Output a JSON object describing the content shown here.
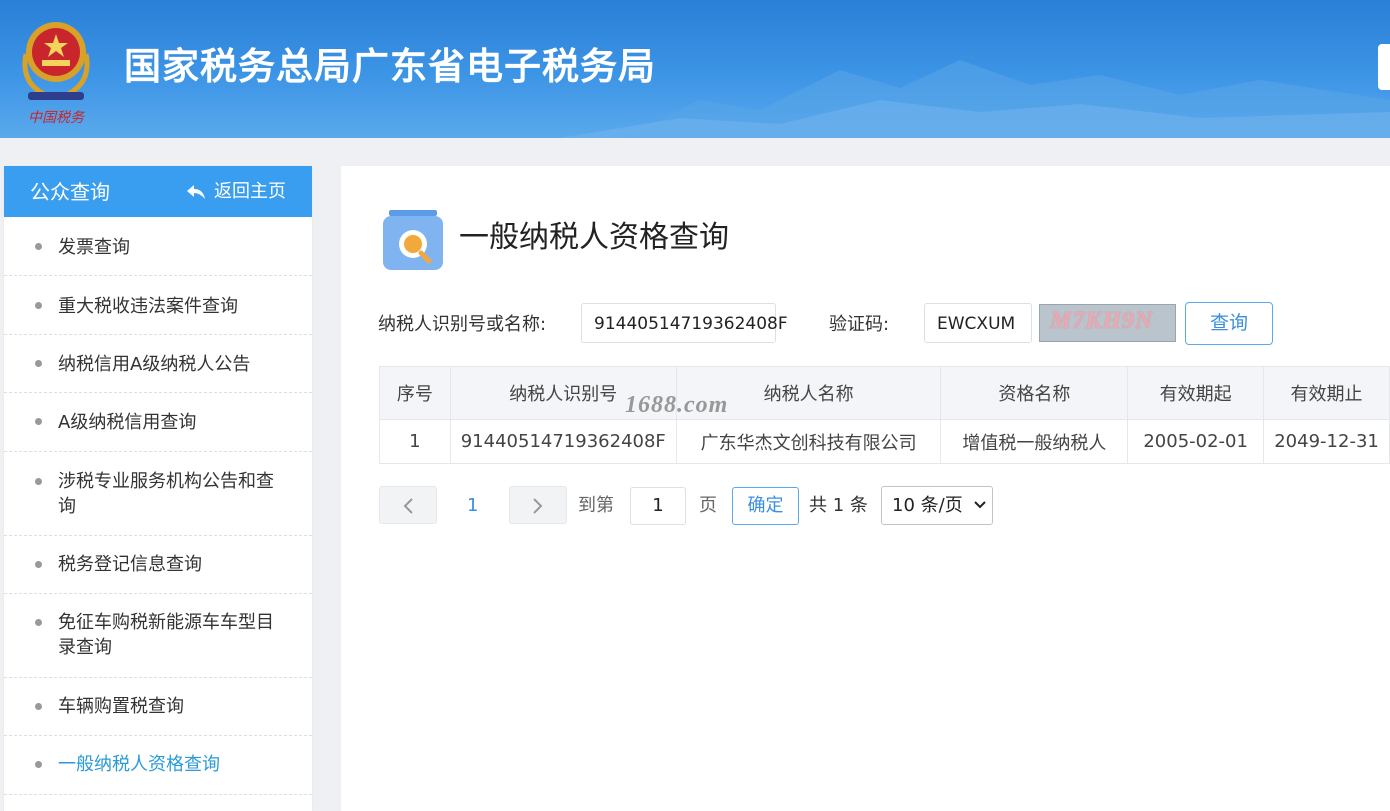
{
  "header": {
    "title": "国家税务总局广东省电子税务局",
    "emblem_caption": "中国税务"
  },
  "sidebar": {
    "title": "公众查询",
    "back_label": "返回主页",
    "items": [
      {
        "label": "发票查询"
      },
      {
        "label": "重大税收违法案件查询"
      },
      {
        "label": "纳税信用A级纳税人公告"
      },
      {
        "label": "A级纳税信用查询"
      },
      {
        "label": "涉税专业服务机构公告和查询"
      },
      {
        "label": "税务登记信息查询"
      },
      {
        "label": "免征车购税新能源车车型目录查询"
      },
      {
        "label": "车辆购置税查询"
      },
      {
        "label": "一般纳税人资格查询",
        "active": true
      }
    ]
  },
  "main": {
    "page_title": "一般纳税人资格查询",
    "form": {
      "taxpayer_label": "纳税人识别号或名称:",
      "taxpayer_value": "91440514719362408F",
      "captcha_label": "验证码:",
      "captcha_value": "EWCXUM",
      "captcha_image_text": "M7KH9N",
      "query_button": "查询"
    },
    "table": {
      "headers": [
        "序号",
        "纳税人识别号",
        "纳税人名称",
        "资格名称",
        "有效期起",
        "有效期止"
      ],
      "rows": [
        [
          "1",
          "91440514719362408F",
          "广东华杰文创科技有限公司",
          "增值税一般纳税人",
          "2005-02-01",
          "2049-12-31"
        ]
      ]
    },
    "watermark": "1688.com",
    "pagination": {
      "current_page": "1",
      "goto_label": "到第",
      "goto_value": "1",
      "page_unit": "页",
      "confirm_label": "确定",
      "total_label": "共 1 条",
      "page_size": "10 条/页"
    }
  },
  "colors": {
    "header_blue": "#2a7fd6",
    "sidebar_head": "#3a9ef0",
    "active_link": "#2a9bd8",
    "accent": "#3a8fe0"
  }
}
